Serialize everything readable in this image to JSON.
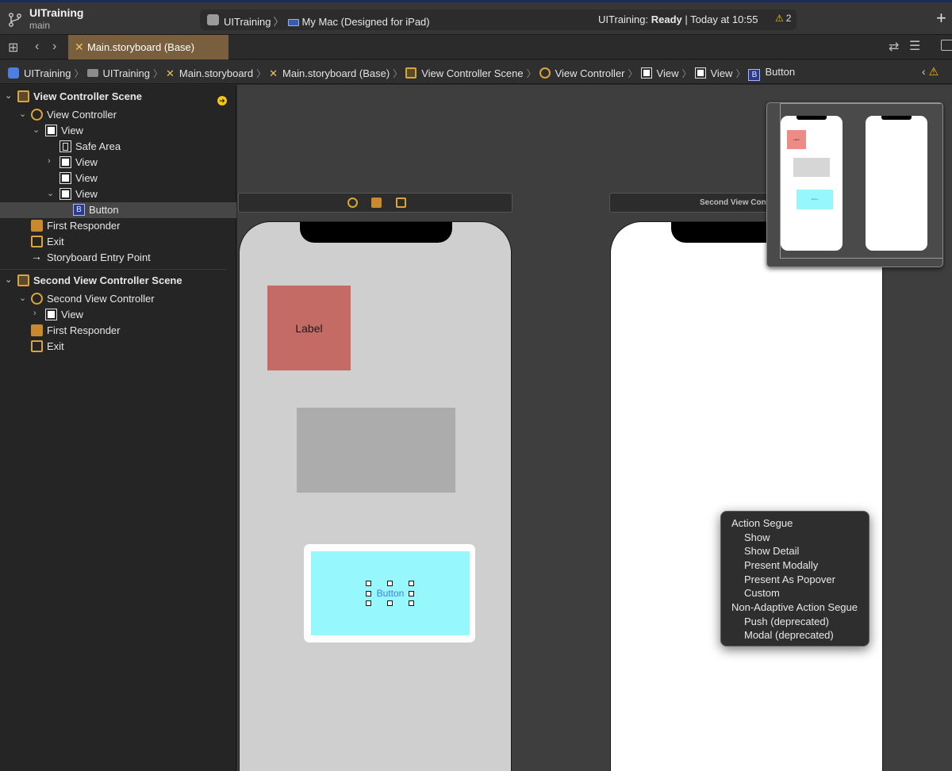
{
  "titlebar": {
    "project": "UITraining",
    "branch": "main",
    "scheme": "UITraining",
    "destination": "My Mac (Designed for iPad)",
    "status_prefix": "UITraining:",
    "status_state": "Ready",
    "status_suffix": "| Today at 10:55",
    "warning_count": "2"
  },
  "tabs": [
    {
      "label": "Main.storyboard (Base)",
      "active": true
    }
  ],
  "jumpbar": {
    "crumbs": [
      "UITraining",
      "UITraining",
      "Main.storyboard",
      "Main.storyboard (Base)",
      "View Controller Scene",
      "View Controller",
      "View",
      "View",
      "Button"
    ]
  },
  "outline": {
    "scene1": {
      "title": "View Controller Scene",
      "controller": "View Controller",
      "view": "View",
      "safe_area": "Safe Area",
      "subview1": "View",
      "subview2": "View",
      "subview3": "View",
      "button": "Button",
      "first_responder": "First Responder",
      "exit": "Exit",
      "entry_point": "Storyboard Entry Point"
    },
    "scene2": {
      "title": "Second View Controller Scene",
      "controller": "Second View Controller",
      "view": "View",
      "first_responder": "First Responder",
      "exit": "Exit"
    }
  },
  "canvas": {
    "vc2_header_title": "Second View Controller",
    "label_text": "Label",
    "button_text": "Button",
    "minimap_label_text": "Label",
    "minimap_button_text": "Button"
  },
  "segue_menu": {
    "action_header": "Action Segue",
    "action_items": [
      "Show",
      "Show Detail",
      "Present Modally",
      "Present As Popover",
      "Custom"
    ],
    "non_adaptive_header": "Non-Adaptive Action Segue",
    "non_adaptive_items": [
      "Push (deprecated)",
      "Modal (deprecated)"
    ]
  },
  "colors": {
    "label_bg": "#c46b66",
    "button_bg": "#96f8fc",
    "storyboard_accent": "#d9a53b",
    "warning": "#f5c518",
    "tab_active": "#7a5f3e"
  },
  "icons": {
    "branch": "branch-icon",
    "scene": "scene-icon",
    "view_controller": "view-controller-icon",
    "view": "view-icon",
    "safe_area": "safe-area-icon",
    "button": "button-icon",
    "first_responder": "first-responder-icon",
    "exit": "exit-icon",
    "entry_point": "arrow-right-icon"
  }
}
